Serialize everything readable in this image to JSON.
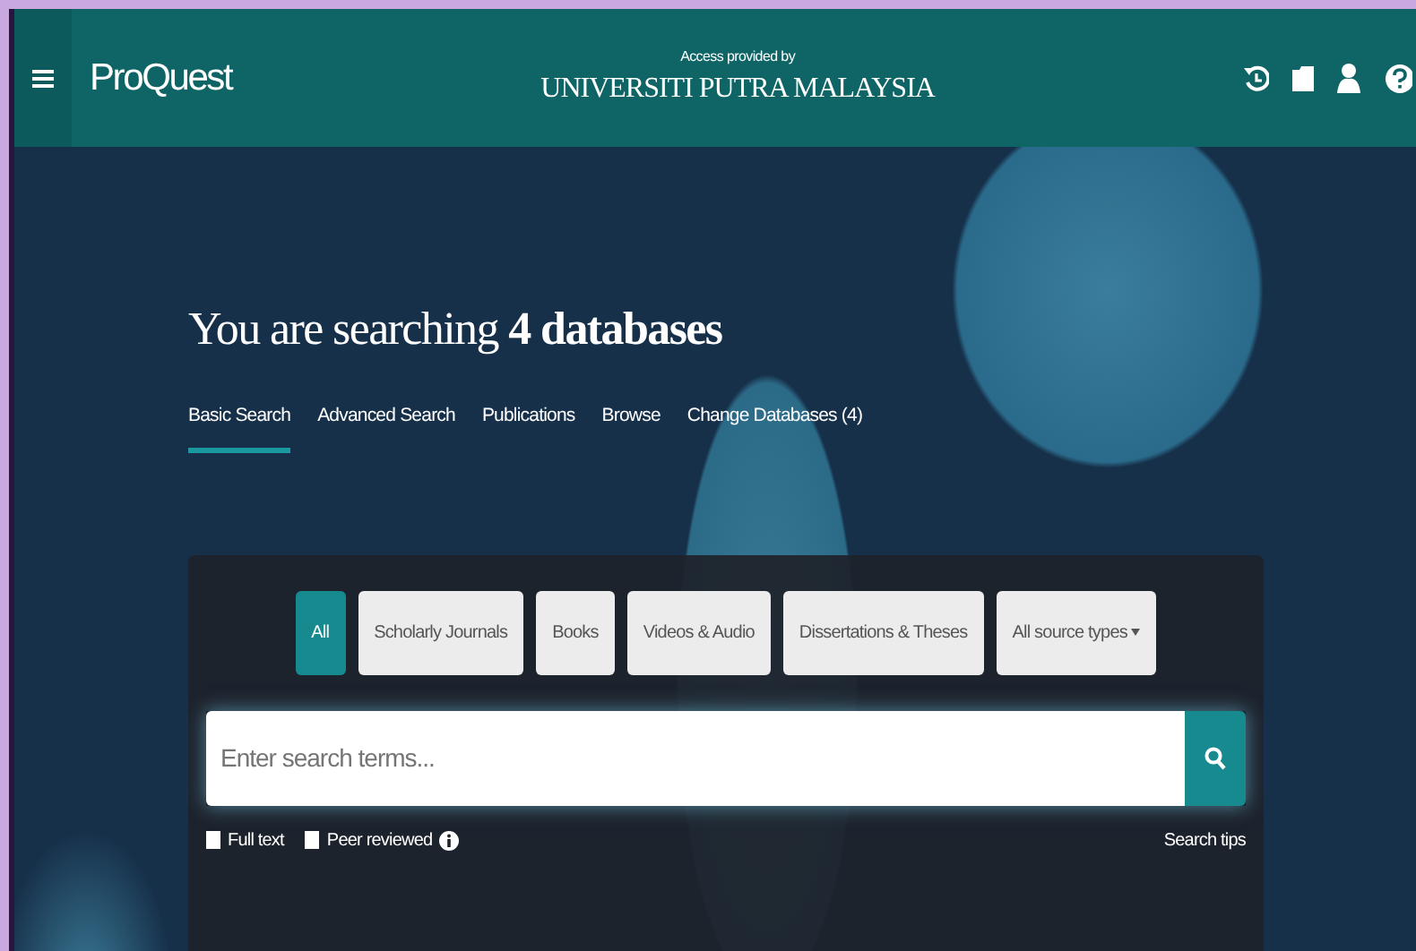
{
  "header": {
    "brand": "ProQuest",
    "access_label": "Access provided by",
    "institution": "UNIVERSITI PUTRA MALAYSIA"
  },
  "hero": {
    "title": "You are searching **4 databases**"
  },
  "tabs": [
    {
      "label": "Basic Search",
      "selected": true
    },
    {
      "label": "Advanced Search",
      "selected": false
    },
    {
      "label": "Publications",
      "selected": false
    },
    {
      "label": "Browse",
      "selected": false
    },
    {
      "label": "Change Databases (4)",
      "selected": false
    }
  ],
  "source_types": [
    {
      "label": "All",
      "selected": true,
      "kind": "chip"
    },
    {
      "label": "Scholarly Journals",
      "selected": false,
      "kind": "chip"
    },
    {
      "label": "Books",
      "selected": false,
      "kind": "chip"
    },
    {
      "label": "Videos & Audio",
      "selected": false,
      "kind": "chip"
    },
    {
      "label": "Dissertations & Theses",
      "selected": false,
      "kind": "chip"
    },
    {
      "label": "All source types",
      "selected": false,
      "kind": "dropdown"
    }
  ],
  "search": {
    "placeholder": "Enter search terms..."
  },
  "filters": [
    {
      "label": "Full text",
      "checked": false,
      "info": false
    },
    {
      "label": "Peer reviewed",
      "checked": false,
      "info": true
    }
  ],
  "search_tips": "Search tips"
}
